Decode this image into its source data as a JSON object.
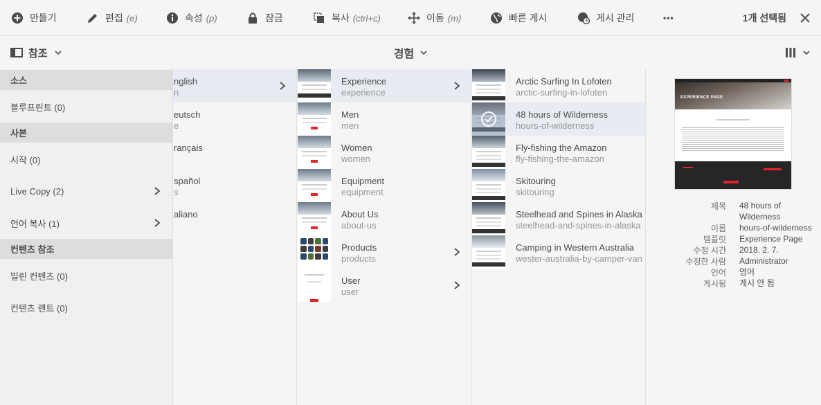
{
  "toolbar": {
    "create": "만들기",
    "edit": "편집",
    "edit_key": "(e)",
    "properties": "속성",
    "properties_key": "(p)",
    "lock": "잠금",
    "copy": "복사",
    "copy_key": "(ctrl+c)",
    "move": "이동",
    "move_key": "(m)",
    "quick_publish": "빠른 게시",
    "manage_publication": "게시 관리",
    "more": "•••",
    "selection": "1개 선택됨"
  },
  "subheader": {
    "rail_label": "참조",
    "page_title": "경험"
  },
  "rail": {
    "sections": [
      {
        "header": "소스",
        "items": [
          {
            "label": "블루프린트 (0)",
            "has_arrow": false
          }
        ]
      },
      {
        "header": "사본",
        "items": [
          {
            "label": "시작 (0)",
            "has_arrow": false
          },
          {
            "label": "Live Copy (2)",
            "has_arrow": true
          },
          {
            "label": "언어 복사 (1)",
            "has_arrow": true
          }
        ]
      },
      {
        "header": "컨텐츠 참조",
        "items": [
          {
            "label": "빌린 컨텐츠 (0)",
            "has_arrow": false
          },
          {
            "label": "컨텐츠 렌트 (0)",
            "has_arrow": false
          }
        ]
      }
    ]
  },
  "column1": [
    {
      "title": "nglish",
      "sub": "n"
    },
    {
      "title": "eutsch",
      "sub": "e"
    },
    {
      "title": "rançais",
      "sub": ""
    },
    {
      "title": "spañol",
      "sub": "s"
    },
    {
      "title": "aliano",
      "sub": ""
    }
  ],
  "column2": [
    {
      "title": "Experience",
      "sub": "experience",
      "arrow": true
    },
    {
      "title": "Men",
      "sub": "men",
      "arrow": false
    },
    {
      "title": "Women",
      "sub": "women",
      "arrow": false
    },
    {
      "title": "Equipment",
      "sub": "equipment",
      "arrow": false
    },
    {
      "title": "About Us",
      "sub": "about-us",
      "arrow": false
    },
    {
      "title": "Products",
      "sub": "products",
      "arrow": true
    },
    {
      "title": "User",
      "sub": "user",
      "arrow": true
    }
  ],
  "column3": [
    {
      "title": "Arctic Surfing In Lofoten",
      "sub": "arctic-surfing-in-lofoten"
    },
    {
      "title": "48 hours of Wilderness",
      "sub": "hours-of-wilderness"
    },
    {
      "title": "Fly-fishing the Amazon",
      "sub": "fly-fishing-the-amazon"
    },
    {
      "title": "Skitouring",
      "sub": "skitouring"
    },
    {
      "title": "Steelhead and Spines in Alaska",
      "sub": "steelhead-and-spines-in-alaska"
    },
    {
      "title": "Camping in Western Australia",
      "sub": "wester-australia-by-camper-van"
    }
  ],
  "preview": {
    "meta": [
      {
        "label": "제목",
        "value": "48 hours of Wilderness"
      },
      {
        "label": "이름",
        "value": "hours-of-wilderness"
      },
      {
        "label": "템플릿",
        "value": "Experience Page"
      },
      {
        "label": "수정 시간",
        "value": "2018. 2. 7."
      },
      {
        "label": "수정한 사람",
        "value": "Administrator"
      },
      {
        "label": "언어",
        "value": "영어"
      },
      {
        "label": "게시됨",
        "value": "게시 안 됨"
      }
    ],
    "thumb_heading": "EXPERIENCE PAGE"
  },
  "colors": {
    "accent_red": "#e0262b",
    "selected_row": "#e8ecf2",
    "text": "#4b4b4b",
    "muted": "#959595"
  }
}
